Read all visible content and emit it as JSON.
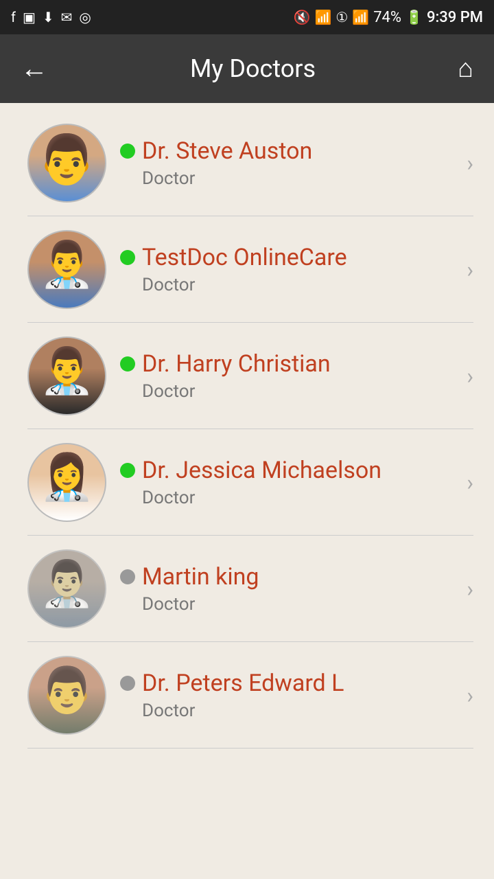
{
  "statusBar": {
    "time": "9:39 PM",
    "battery": "74%",
    "icons": [
      "facebook",
      "image",
      "download",
      "mail",
      "instagram",
      "mute",
      "wifi",
      "sim",
      "signal",
      "battery"
    ]
  },
  "nav": {
    "title": "My Doctors",
    "backLabel": "←",
    "homeLabel": "⌂"
  },
  "doctors": [
    {
      "id": 1,
      "name": "Dr. Steve Auston",
      "role": "Doctor",
      "status": "online",
      "avatarClass": "avatar-1"
    },
    {
      "id": 2,
      "name": "TestDoc OnlineCare",
      "role": "Doctor",
      "status": "online",
      "avatarClass": "avatar-2"
    },
    {
      "id": 3,
      "name": "Dr. Harry Christian",
      "role": "Doctor",
      "status": "online",
      "avatarClass": "avatar-3"
    },
    {
      "id": 4,
      "name": "Dr. Jessica Michaelson",
      "role": "Doctor",
      "status": "online",
      "avatarClass": "avatar-4"
    },
    {
      "id": 5,
      "name": "Martin king",
      "role": "Doctor",
      "status": "offline",
      "avatarClass": "avatar-5"
    },
    {
      "id": 6,
      "name": "Dr. Peters Edward L",
      "role": "Doctor",
      "status": "offline",
      "avatarClass": "avatar-6"
    }
  ],
  "colors": {
    "navBg": "#3a3a3a",
    "statusBarBg": "#222222",
    "listBg": "#f0ebe3",
    "nameColor": "#c04020",
    "roleColor": "#777777",
    "onlineDot": "#22cc22",
    "offlineDot": "#999999"
  }
}
